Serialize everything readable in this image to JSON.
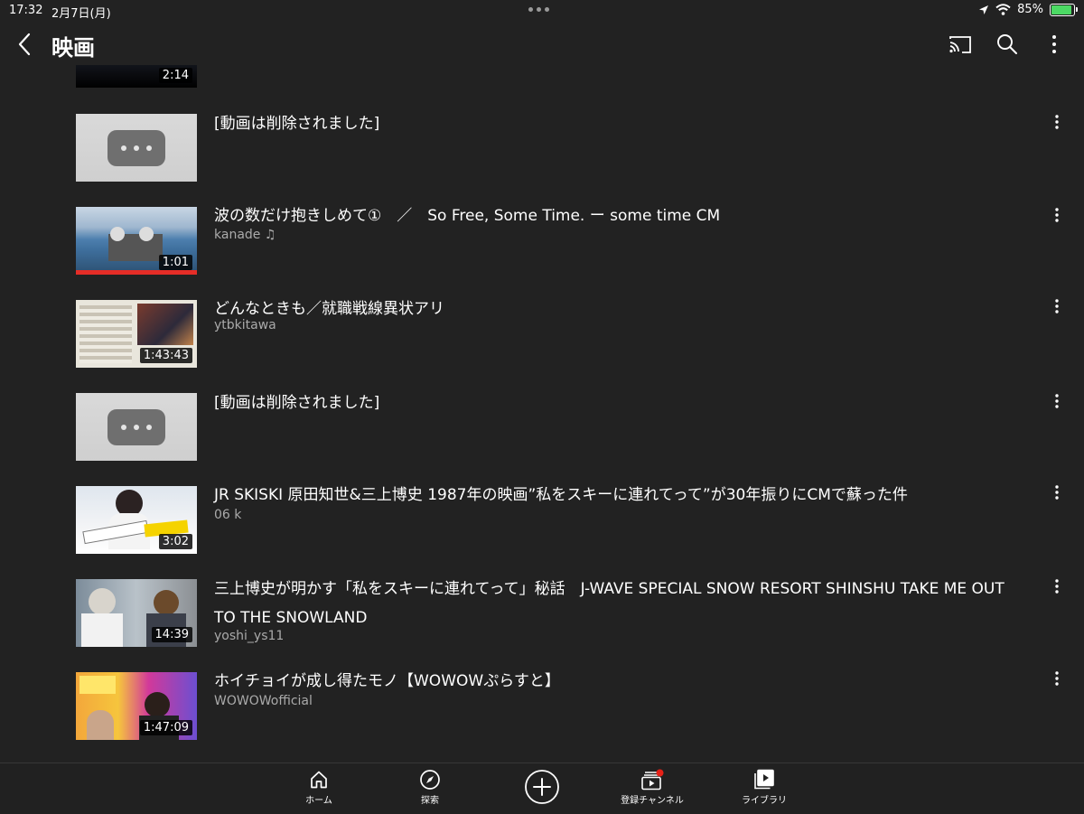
{
  "status_bar": {
    "time": "17:32",
    "date": "2月7日(月)",
    "battery": "85%"
  },
  "header": {
    "title": "映画",
    "icons": [
      "back-icon",
      "cast-icon",
      "search-icon",
      "more-vert-icon"
    ]
  },
  "videos": [
    {
      "title": "",
      "channel": "",
      "duration": "2:14"
    },
    {
      "title": "[動画は削除されました]",
      "channel": "",
      "duration": ""
    },
    {
      "title": "波の数だけ抱きしめて①　／　So Free, Some Time. ー some time CM",
      "channel": "kanade ♫",
      "duration": "1:01"
    },
    {
      "title": "どんなときも／就職戦線異状アリ",
      "channel": "ytbkitawa",
      "duration": "1:43:43"
    },
    {
      "title": "[動画は削除されました]",
      "channel": "",
      "duration": ""
    },
    {
      "title": "JR SKISKI 原田知世&三上博史 1987年の映画”私をスキーに連れてって”が30年振りにCMで蘇った件",
      "channel": "06 k",
      "duration": "3:02"
    },
    {
      "title": "三上博史が明かす「私をスキーに連れてって」秘話　J-WAVE SPECIAL SNOW RESORT SHINSHU TAKE ME OUT TO THE SNOWLAND",
      "channel": "yoshi_ys11",
      "duration": "14:39"
    },
    {
      "title": "ホイチョイが成し得たモノ【WOWOWぷらすと】",
      "channel": "WOWOWofficial",
      "duration": "1:47:09"
    }
  ],
  "tabs": [
    {
      "label": "ホーム",
      "icon": "home-icon"
    },
    {
      "label": "探索",
      "icon": "explore-icon"
    },
    {
      "label": "",
      "icon": "create-icon"
    },
    {
      "label": "登録チャンネル",
      "icon": "subscriptions-icon"
    },
    {
      "label": "ライブラリ",
      "icon": "library-icon"
    }
  ],
  "colors": {
    "background": "#222222",
    "text": "#ffffff",
    "secondary_text": "#aaaaaa",
    "notification_dot": "#e62117",
    "battery_fill": "#4cd964"
  }
}
